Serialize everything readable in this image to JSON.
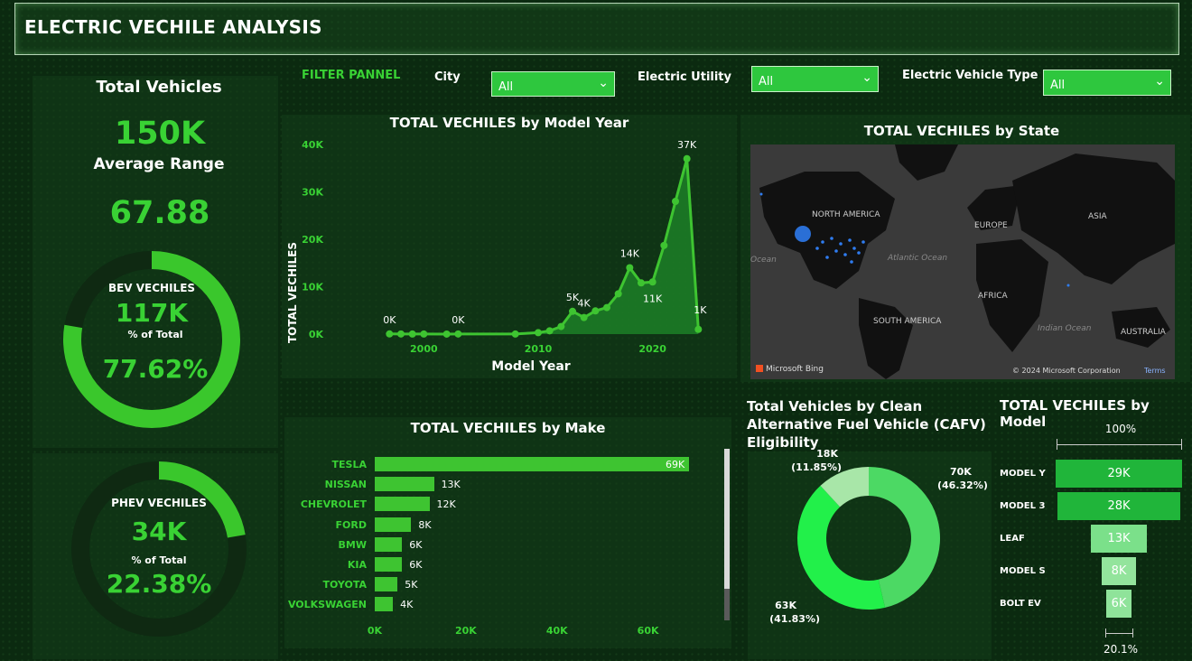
{
  "header": {
    "title": "ELECTRIC VECHILE ANALYSIS"
  },
  "kpis": {
    "total_vehicles_label": "Total Vehicles",
    "total_vehicles_value": "150K",
    "avg_range_label": "Average Range",
    "avg_range_value": "67.88",
    "bev": {
      "label": "BEV VECHILES",
      "value": "117K",
      "pct_label": "% of Total",
      "pct_value": "77.62%",
      "fraction": 0.7762
    },
    "phev": {
      "label": "PHEV VECHILES",
      "value": "34K",
      "pct_label": "% of Total",
      "pct_value": "22.38%",
      "fraction": 0.2238
    }
  },
  "filters": {
    "panel_label": "FILTER PANNEL",
    "city": {
      "label": "City",
      "value": "All"
    },
    "utility": {
      "label": "Electric Utility",
      "value": "All"
    },
    "ev_type": {
      "label": "Electric Vehicle Type",
      "value": "All"
    }
  },
  "colors": {
    "accent": "#39d234",
    "bar": "#3ec431",
    "area": "#1f8a2a",
    "donut_a": "#4cd964",
    "donut_b": "#22f04a",
    "donut_c": "#a8e6a8"
  },
  "map": {
    "title": "TOTAL VECHILES by State",
    "labels": {
      "north_america": "NORTH AMERICA",
      "europe": "EUROPE",
      "asia": "ASIA",
      "africa": "AFRICA",
      "south_america": "SOUTH AMERICA",
      "australia": "AUSTRALIA",
      "atlantic": "Atlantic Ocean",
      "indian": "Indian Ocean",
      "ocean": "Ocean"
    },
    "brand": "Microsoft Bing",
    "copyright": "© 2024 Microsoft Corporation",
    "terms": "Terms"
  },
  "chart_data": [
    {
      "type": "area",
      "title": "TOTAL VECHILES by Model Year",
      "xlabel": "Model Year",
      "ylabel": "TOTAL VECHILES",
      "ylim": [
        0,
        40000
      ],
      "yticks": [
        "0K",
        "10K",
        "20K",
        "30K",
        "40K"
      ],
      "xticks": [
        "2000",
        "2010",
        "2020"
      ],
      "x": [
        1997,
        1998,
        1999,
        2000,
        2002,
        2003,
        2008,
        2010,
        2011,
        2012,
        2013,
        2014,
        2015,
        2016,
        2017,
        2018,
        2019,
        2020,
        2021,
        2022,
        2023,
        2024
      ],
      "values": [
        40,
        30,
        20,
        20,
        10,
        30,
        20,
        300,
        700,
        1600,
        4800,
        3500,
        4900,
        5600,
        8500,
        14000,
        10800,
        11000,
        18700,
        28000,
        37000,
        1000
      ],
      "data_labels": [
        {
          "x": 1997,
          "text": "0K"
        },
        {
          "x": 2003,
          "text": "0K"
        },
        {
          "x": 2013,
          "text": "5K"
        },
        {
          "x": 2014,
          "text": "4K"
        },
        {
          "x": 2018,
          "text": "14K"
        },
        {
          "x": 2020,
          "text": "11K"
        },
        {
          "x": 2023,
          "text": "37K"
        },
        {
          "x": 2024,
          "text": "1K"
        }
      ]
    },
    {
      "type": "bar",
      "orientation": "horizontal",
      "title": "TOTAL VECHILES by Make",
      "categories": [
        "TESLA",
        "NISSAN",
        "CHEVROLET",
        "FORD",
        "BMW",
        "KIA",
        "TOYOTA",
        "VOLKSWAGEN"
      ],
      "values": [
        69000,
        13000,
        12000,
        8000,
        6000,
        6000,
        5000,
        4000
      ],
      "labels": [
        "69K",
        "13K",
        "12K",
        "8K",
        "6K",
        "6K",
        "5K",
        "4K"
      ],
      "xticks": [
        "0K",
        "20K",
        "40K",
        "60K"
      ],
      "xlim": [
        0,
        69000
      ]
    },
    {
      "type": "pie",
      "donut": true,
      "title": "Total Vehicles by Clean Alternative Fuel Vehicle (CAFV) Eligibility",
      "values": [
        46.32,
        41.83,
        11.85
      ],
      "labels": [
        "70K",
        "63K",
        "18K"
      ],
      "percent_labels": [
        "(46.32%)",
        "(41.83%)",
        "(11.85%)"
      ]
    },
    {
      "type": "bar",
      "subtype": "funnel",
      "title": "TOTAL VECHILES by Model",
      "categories": [
        "MODEL Y",
        "MODEL 3",
        "LEAF",
        "MODEL S",
        "BOLT EV"
      ],
      "values": [
        29000,
        28000,
        13000,
        8000,
        6000
      ],
      "labels": [
        "29K",
        "28K",
        "13K",
        "8K",
        "6K"
      ],
      "top_label": "100%",
      "bottom_label": "20.1%"
    }
  ]
}
